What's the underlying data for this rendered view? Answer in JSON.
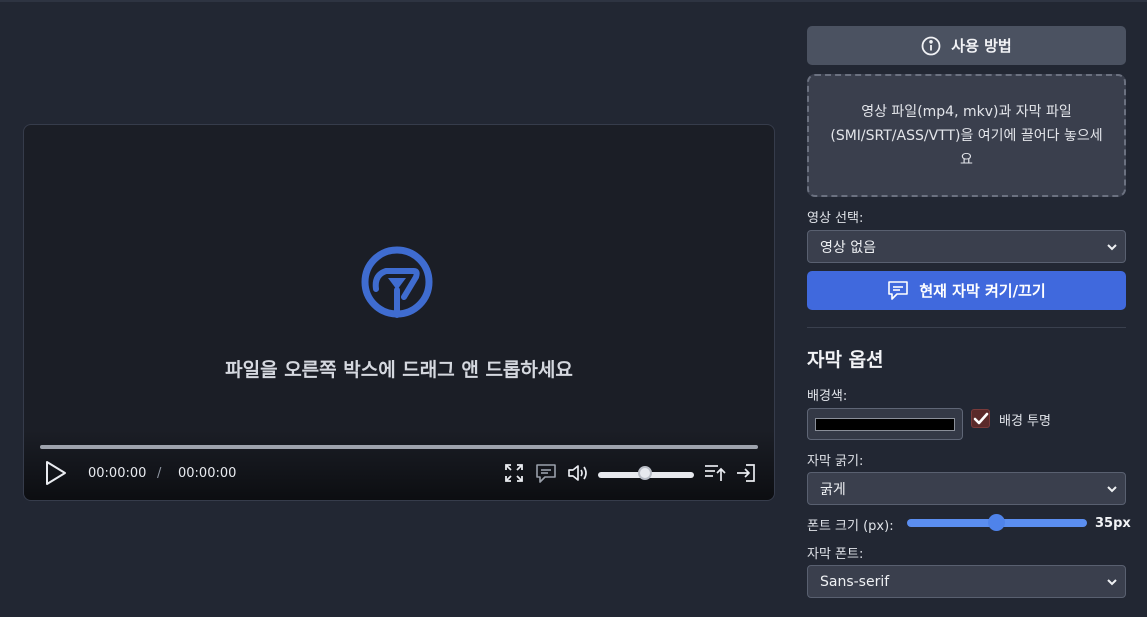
{
  "player": {
    "logo_icon": "play-hand-logo-icon",
    "message": "파일을 오른쪽 박스에 드래그 앤 드롭하세요",
    "current_time": "00:00:00",
    "time_separator": "/",
    "duration": "00:00:00",
    "progress": 0,
    "volume": 0.5
  },
  "sidebar": {
    "help_label": "사용 방법",
    "dropzone_text": "영상 파일(mp4, mkv)과 자막 파일 (SMI/SRT/ASS/VTT)을 여기에 끌어다 놓으세요",
    "video_select_label": "영상 선택:",
    "video_select_value": "영상 없음",
    "toggle_subtitle_label": "현재 자막 켜기/끄기",
    "options_title": "자막 옵션",
    "bg_color_label": "배경색:",
    "bg_color_value": "#000000",
    "bg_transparent_label": "배경 투명",
    "bg_transparent_checked": true,
    "weight_label": "자막 굵기:",
    "weight_value": "굵게",
    "font_size_label": "폰트 크기 (px):",
    "font_size_value": "35px",
    "font_size": 35,
    "font_label": "자막 폰트:",
    "font_value": "Sans-serif"
  },
  "colors": {
    "accent": "#4069dd",
    "logo": "#3f6cd0",
    "background": "#222733"
  }
}
